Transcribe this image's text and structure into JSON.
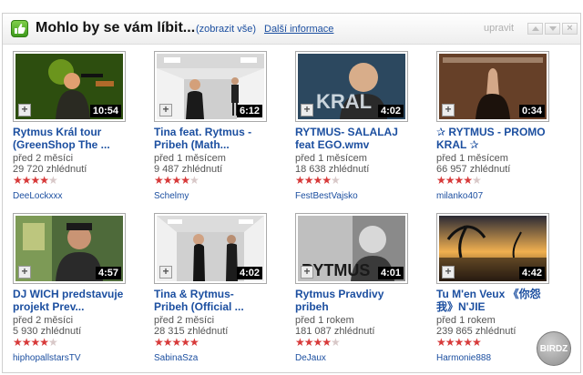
{
  "header": {
    "title": "Mohlo by se vám líbit...",
    "view_all": "(zobrazit vše)",
    "more_info": "Další informace",
    "edit": "upravit"
  },
  "videos": [
    {
      "title1": "Rytmus Král tour",
      "title2": "(GreenShop The ...",
      "age": "před 2 měsíci",
      "views": "29 720 zhlédnutí",
      "rating": 4.5,
      "author": "DeeLockxxx",
      "duration": "10:54"
    },
    {
      "title1": "Tina feat. Rytmus -",
      "title2": "Pribeh (Math...",
      "age": "před 1 měsícem",
      "views": "9 487 zhlédnutí",
      "rating": 4.5,
      "author": "Schelmy",
      "duration": "6:12"
    },
    {
      "title1": "RYTMUS- SALALAJ",
      "title2": "feat EGO.wmv",
      "age": "před 1 měsícem",
      "views": "18 638 zhlédnutí",
      "rating": 4.5,
      "author": "FestBestVajsko",
      "duration": "4:02"
    },
    {
      "title1": "✰ RYTMUS - PROMO",
      "title2": "KRAL ✰",
      "age": "před 1 měsícem",
      "views": "66 957 zhlédnutí",
      "rating": 4.5,
      "author": "milanko407",
      "duration": "0:34"
    },
    {
      "title1": "DJ WICH predstavuje",
      "title2": "projekt Prev...",
      "age": "před 2 měsíci",
      "views": "5 930 zhlédnutí",
      "rating": 4.5,
      "author": "hiphopallstarsTV",
      "duration": "4:57"
    },
    {
      "title1": "Tina & Rytmus-",
      "title2": "Pribeh (Official ...",
      "age": "před 2 měsíci",
      "views": "28 315 zhlédnutí",
      "rating": 5,
      "author": "SabinaSza",
      "duration": "4:02"
    },
    {
      "title1": "Rytmus Pravdivy",
      "title2": "pribeh",
      "age": "před 1 rokem",
      "views": "181 087 zhlédnutí",
      "rating": 4.5,
      "author": "DeJaux",
      "duration": "4:01"
    },
    {
      "title1": "Tu M'en Veux 《你怨",
      "title2": "我》N'JIE",
      "age": "před 1 rokem",
      "views": "239 865 zhlédnutí",
      "rating": 5,
      "author": "Harmonie888",
      "duration": "4:42"
    }
  ],
  "watermark": "BIRDZ",
  "colors": {
    "link": "#1c4fa0",
    "stars": "#d73a3a",
    "header_icon": "#4caf2a"
  }
}
